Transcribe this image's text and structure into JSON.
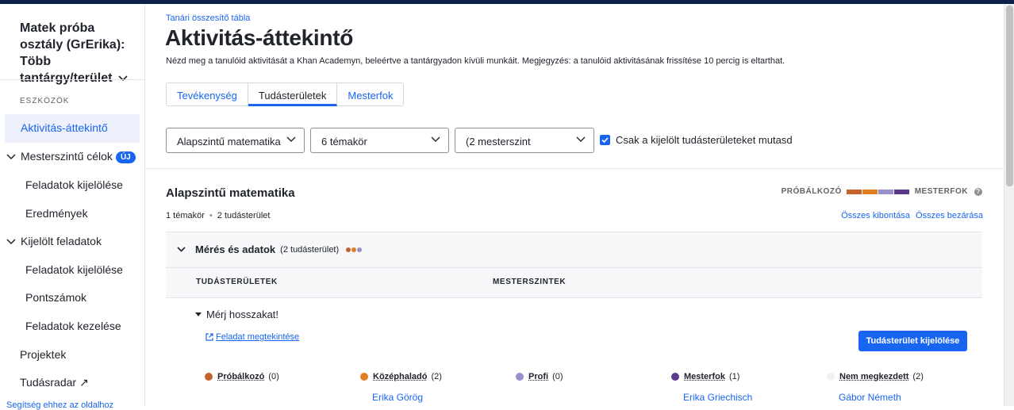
{
  "sidebar": {
    "class_title": "Matek próba osztály (GrErika): Több tantárgy/terület",
    "section_label": "ESZKÖZÖK",
    "items": [
      {
        "label": "Aktivitás-áttekintő",
        "active": true
      },
      {
        "label": "Mesterszintű célok",
        "badge": "ÚJ",
        "expandable": true
      },
      {
        "label": "Feladatok kijelölése",
        "child": true
      },
      {
        "label": "Eredmények",
        "child": true
      },
      {
        "label": "Kijelölt feladatok",
        "expandable": true
      },
      {
        "label": "Feladatok kijelölése",
        "child": true
      },
      {
        "label": "Pontszámok",
        "child": true
      },
      {
        "label": "Feladatok kezelése",
        "child": true
      },
      {
        "label": "Projektek"
      },
      {
        "label": "Tudásradar ↗"
      }
    ],
    "footer_link": "Segítség ehhez az oldalhoz"
  },
  "header": {
    "breadcrumb": "Tanári összesítő tábla",
    "title": "Aktivitás-áttekintő",
    "description": "Nézd meg a tanulóid aktivitását a Khan Academyn, beleértve a tantárgyadon kívüli munkáit. Megjegyzés: a tanulóid aktivitásának frissítése 10 percig is eltarthat."
  },
  "tabs": [
    {
      "label": "Tevékenység",
      "selected": false
    },
    {
      "label": "Tudásterületek",
      "selected": true
    },
    {
      "label": "Mesterfok",
      "selected": false
    }
  ],
  "filters": {
    "subject": "Alapszintű matematika",
    "units": "6 témakör",
    "mastery": "(2 mesterszint",
    "checkbox_label": "Csak a kijelölt tudásterületeket mutasd",
    "checkbox_checked": true
  },
  "section": {
    "title": "Alapszintű matematika",
    "meta_units": "1 témakör",
    "meta_skills": "2 tudásterület",
    "legend_start": "PRÓBÁLKOZÓ",
    "legend_end": "MESTERFOK",
    "legend_colors": [
      "#c6632a",
      "#e07e22",
      "#9a8fcb",
      "#5b3a8c"
    ],
    "expand_all": "Összes kibontása",
    "collapse_all": "Összes bezárása"
  },
  "group": {
    "name": "Mérés és adatok",
    "count": "(2 tudásterület)",
    "col_skills": "TUDÁSTERÜLETEK",
    "col_levels": "MESTERSZINTEK"
  },
  "skill": {
    "name": "Mérj hosszakat!",
    "exercise_link": "Feladat megtekintése",
    "assign_button": "Tudásterület kijelölése",
    "levels": [
      {
        "name": "Próbálkozó",
        "count": "(0)",
        "color": "#c6632a",
        "student": ""
      },
      {
        "name": "Középhaladó",
        "count": "(2)",
        "color": "#e07e22",
        "student": "Erika Görög"
      },
      {
        "name": "Profi",
        "count": "(0)",
        "color": "#9a8fcb",
        "student": ""
      },
      {
        "name": "Mesterfok",
        "count": "(1)",
        "color": "#5b3a8c",
        "student": "Erika Griechisch"
      },
      {
        "name": "Nem megkezdett",
        "count": "(2)",
        "color": "#f0f1f2",
        "student": "Gábor Németh"
      }
    ]
  }
}
